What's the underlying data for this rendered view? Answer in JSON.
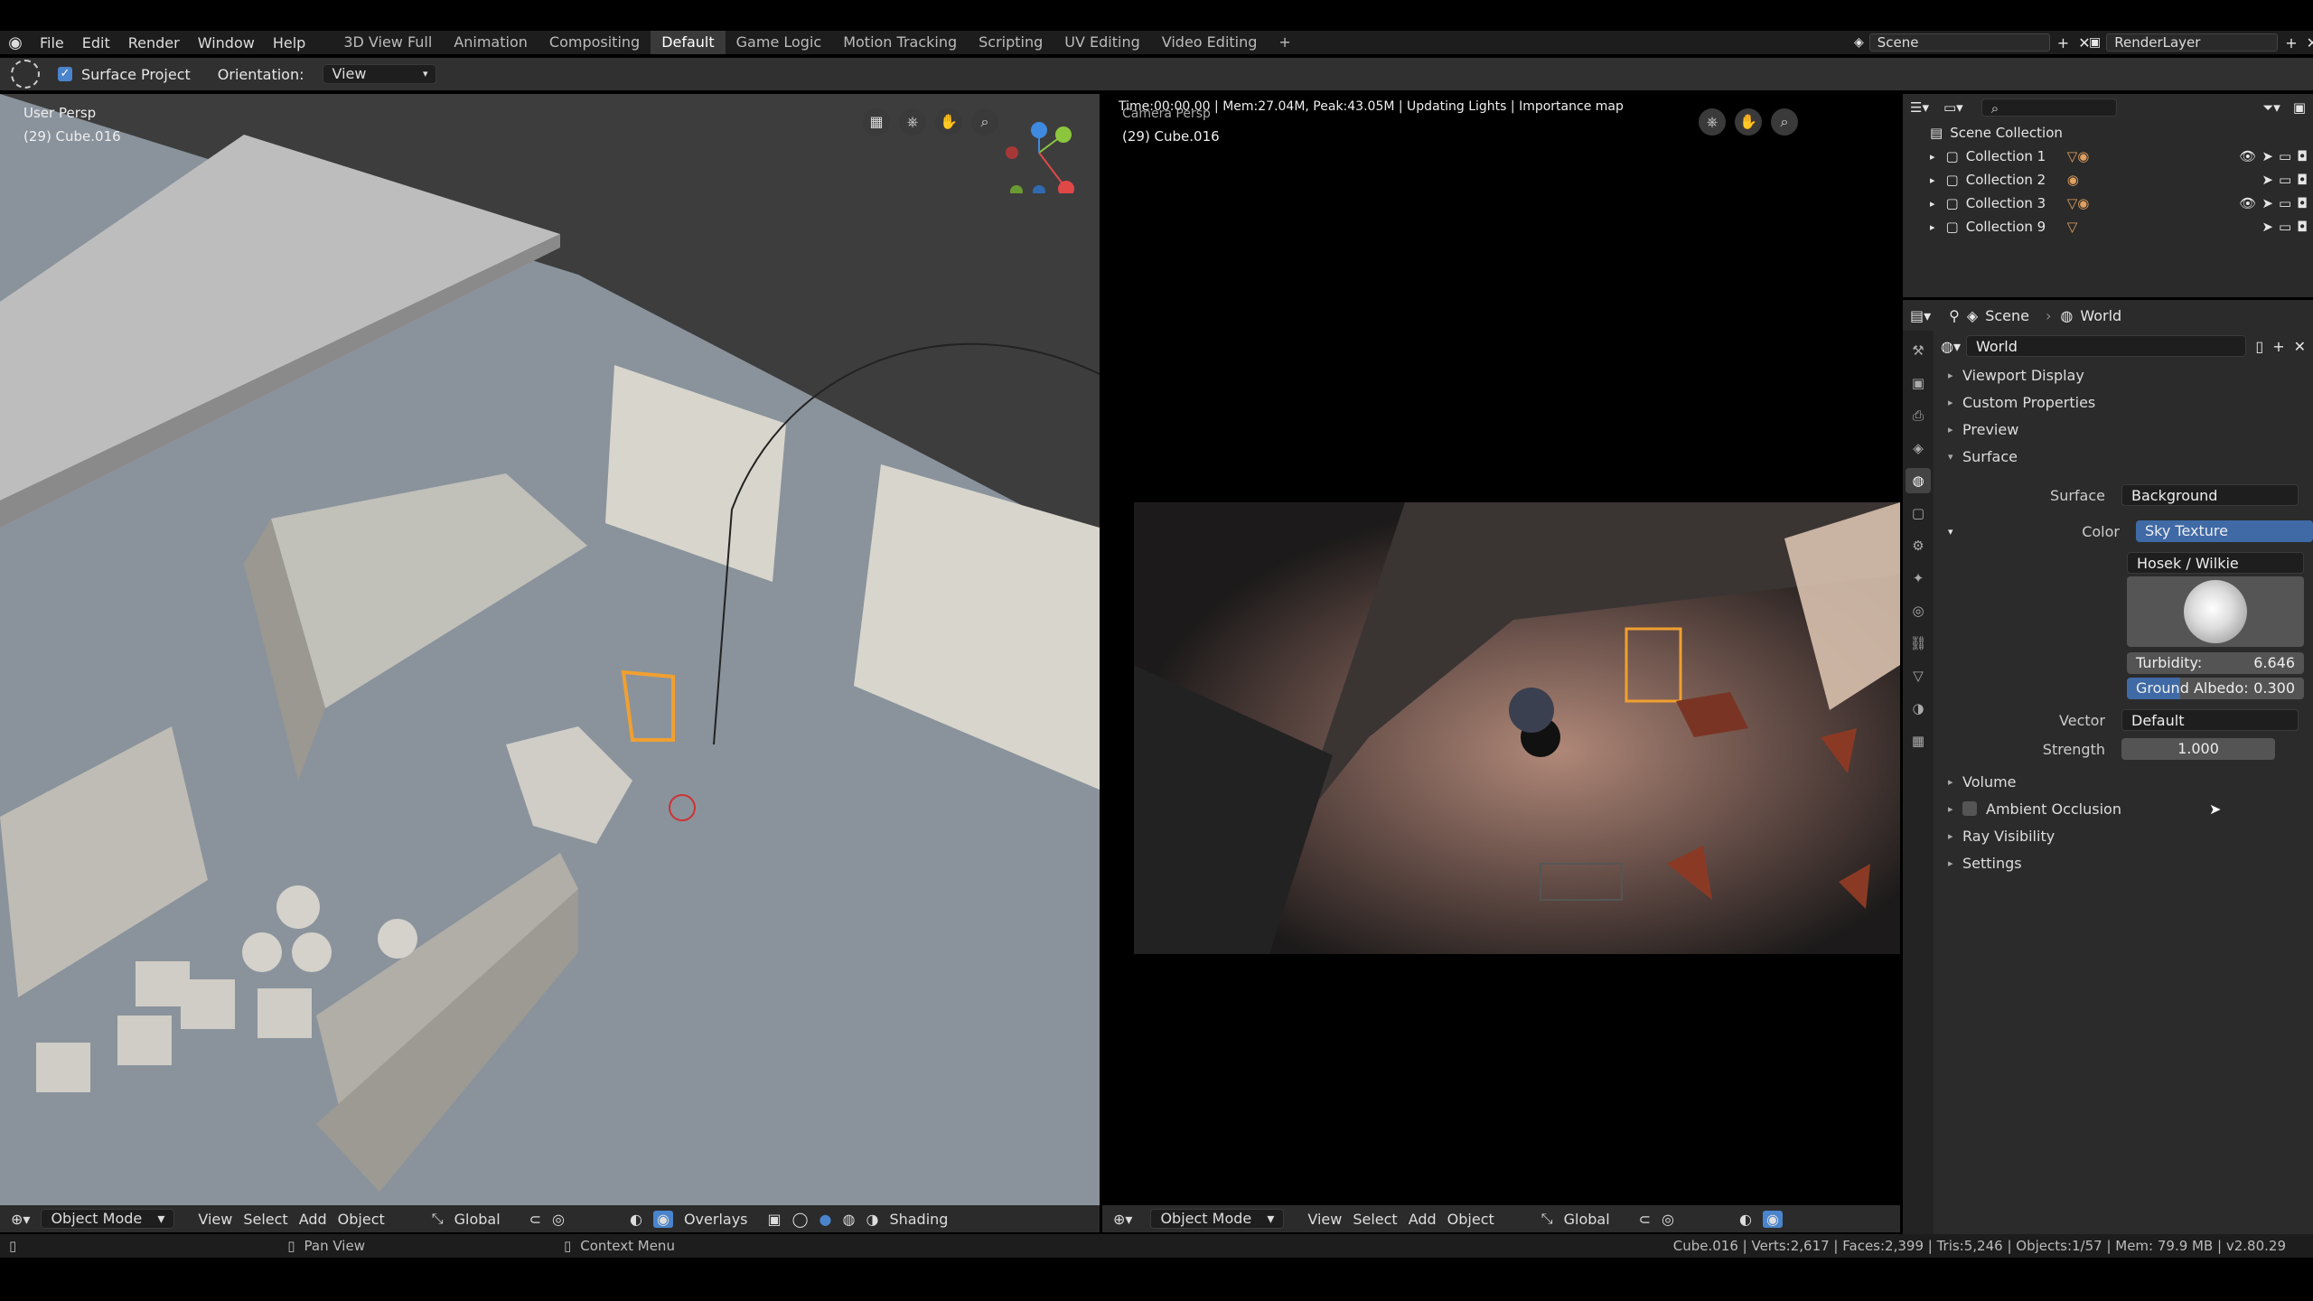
{
  "menu": [
    "File",
    "Edit",
    "Render",
    "Window",
    "Help"
  ],
  "workspace_tabs": [
    "3D View Full",
    "Animation",
    "Compositing",
    "Default",
    "Game Logic",
    "Motion Tracking",
    "Scripting",
    "UV Editing",
    "Video Editing"
  ],
  "active_tab": "Default",
  "scene": {
    "label": "Scene",
    "render_layer": "RenderLayer"
  },
  "toolbar": {
    "surface_project": "Surface Project",
    "orientation_label": "Orientation:",
    "orientation_value": "View"
  },
  "viewport_left": {
    "view_name": "User Persp",
    "object": "(29) Cube.016"
  },
  "viewport_right": {
    "render_info": "Time:00:00.00 | Mem:27.04M, Peak:43.05M | Updating Lights | Importance map",
    "view_name": "Camera Persp",
    "object": "(29) Cube.016"
  },
  "vp_header": {
    "mode": "Object Mode",
    "view": "View",
    "select": "Select",
    "add": "Add",
    "object": "Object",
    "transform": "Global",
    "overlays": "Overlays",
    "shading": "Shading"
  },
  "outliner": {
    "root": "Scene Collection",
    "items": [
      "Collection 1",
      "Collection 2",
      "Collection 3",
      "Collection 9"
    ]
  },
  "properties": {
    "breadcrumb_scene": "Scene",
    "breadcrumb_world": "World",
    "world_name": "World",
    "panels_top": [
      "Viewport Display",
      "Custom Properties",
      "Preview",
      "Surface"
    ],
    "surface_label": "Surface",
    "surface_value": "Background",
    "color_label": "Color",
    "color_value": "Sky Texture",
    "sky_model": "Hosek / Wilkie",
    "turbidity_label": "Turbidity:",
    "turbidity_value": "6.646",
    "albedo_label": "Ground Albedo:",
    "albedo_value": "0.300",
    "vector_label": "Vector",
    "vector_value": "Default",
    "strength_label": "Strength",
    "strength_value": "1.000",
    "panels_bottom": [
      "Volume",
      "Ambient Occlusion",
      "Ray Visibility",
      "Settings"
    ]
  },
  "statusbar": {
    "pan": "Pan View",
    "context": "Context Menu",
    "stats": "Cube.016 | Verts:2,617 | Faces:2,399 | Tris:5,246 | Objects:1/57 | Mem: 79.9 MB | v2.80.29"
  },
  "colors": {
    "accent": "#4a84cc",
    "selection": "#f0a030",
    "viewport_bg": "#8a939c"
  }
}
